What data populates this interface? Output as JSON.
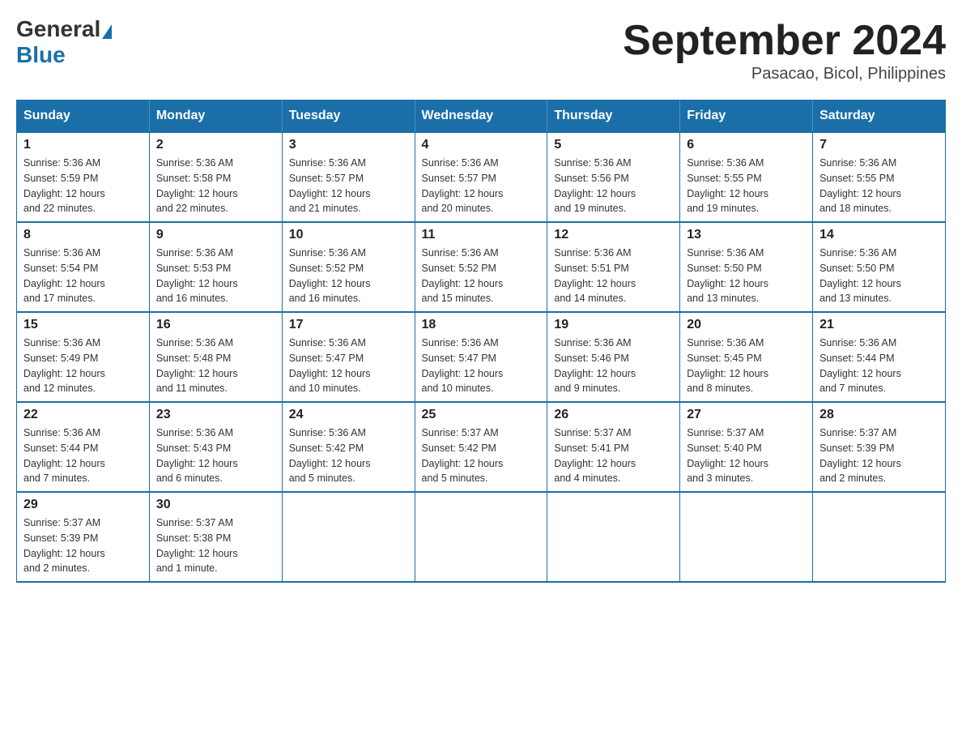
{
  "header": {
    "logo_general": "General",
    "logo_blue": "Blue",
    "month_title": "September 2024",
    "subtitle": "Pasacao, Bicol, Philippines"
  },
  "days_of_week": [
    "Sunday",
    "Monday",
    "Tuesday",
    "Wednesday",
    "Thursday",
    "Friday",
    "Saturday"
  ],
  "weeks": [
    [
      {
        "day": "1",
        "sunrise": "5:36 AM",
        "sunset": "5:59 PM",
        "daylight": "12 hours and 22 minutes."
      },
      {
        "day": "2",
        "sunrise": "5:36 AM",
        "sunset": "5:58 PM",
        "daylight": "12 hours and 22 minutes."
      },
      {
        "day": "3",
        "sunrise": "5:36 AM",
        "sunset": "5:57 PM",
        "daylight": "12 hours and 21 minutes."
      },
      {
        "day": "4",
        "sunrise": "5:36 AM",
        "sunset": "5:57 PM",
        "daylight": "12 hours and 20 minutes."
      },
      {
        "day": "5",
        "sunrise": "5:36 AM",
        "sunset": "5:56 PM",
        "daylight": "12 hours and 19 minutes."
      },
      {
        "day": "6",
        "sunrise": "5:36 AM",
        "sunset": "5:55 PM",
        "daylight": "12 hours and 19 minutes."
      },
      {
        "day": "7",
        "sunrise": "5:36 AM",
        "sunset": "5:55 PM",
        "daylight": "12 hours and 18 minutes."
      }
    ],
    [
      {
        "day": "8",
        "sunrise": "5:36 AM",
        "sunset": "5:54 PM",
        "daylight": "12 hours and 17 minutes."
      },
      {
        "day": "9",
        "sunrise": "5:36 AM",
        "sunset": "5:53 PM",
        "daylight": "12 hours and 16 minutes."
      },
      {
        "day": "10",
        "sunrise": "5:36 AM",
        "sunset": "5:52 PM",
        "daylight": "12 hours and 16 minutes."
      },
      {
        "day": "11",
        "sunrise": "5:36 AM",
        "sunset": "5:52 PM",
        "daylight": "12 hours and 15 minutes."
      },
      {
        "day": "12",
        "sunrise": "5:36 AM",
        "sunset": "5:51 PM",
        "daylight": "12 hours and 14 minutes."
      },
      {
        "day": "13",
        "sunrise": "5:36 AM",
        "sunset": "5:50 PM",
        "daylight": "12 hours and 13 minutes."
      },
      {
        "day": "14",
        "sunrise": "5:36 AM",
        "sunset": "5:50 PM",
        "daylight": "12 hours and 13 minutes."
      }
    ],
    [
      {
        "day": "15",
        "sunrise": "5:36 AM",
        "sunset": "5:49 PM",
        "daylight": "12 hours and 12 minutes."
      },
      {
        "day": "16",
        "sunrise": "5:36 AM",
        "sunset": "5:48 PM",
        "daylight": "12 hours and 11 minutes."
      },
      {
        "day": "17",
        "sunrise": "5:36 AM",
        "sunset": "5:47 PM",
        "daylight": "12 hours and 10 minutes."
      },
      {
        "day": "18",
        "sunrise": "5:36 AM",
        "sunset": "5:47 PM",
        "daylight": "12 hours and 10 minutes."
      },
      {
        "day": "19",
        "sunrise": "5:36 AM",
        "sunset": "5:46 PM",
        "daylight": "12 hours and 9 minutes."
      },
      {
        "day": "20",
        "sunrise": "5:36 AM",
        "sunset": "5:45 PM",
        "daylight": "12 hours and 8 minutes."
      },
      {
        "day": "21",
        "sunrise": "5:36 AM",
        "sunset": "5:44 PM",
        "daylight": "12 hours and 7 minutes."
      }
    ],
    [
      {
        "day": "22",
        "sunrise": "5:36 AM",
        "sunset": "5:44 PM",
        "daylight": "12 hours and 7 minutes."
      },
      {
        "day": "23",
        "sunrise": "5:36 AM",
        "sunset": "5:43 PM",
        "daylight": "12 hours and 6 minutes."
      },
      {
        "day": "24",
        "sunrise": "5:36 AM",
        "sunset": "5:42 PM",
        "daylight": "12 hours and 5 minutes."
      },
      {
        "day": "25",
        "sunrise": "5:37 AM",
        "sunset": "5:42 PM",
        "daylight": "12 hours and 5 minutes."
      },
      {
        "day": "26",
        "sunrise": "5:37 AM",
        "sunset": "5:41 PM",
        "daylight": "12 hours and 4 minutes."
      },
      {
        "day": "27",
        "sunrise": "5:37 AM",
        "sunset": "5:40 PM",
        "daylight": "12 hours and 3 minutes."
      },
      {
        "day": "28",
        "sunrise": "5:37 AM",
        "sunset": "5:39 PM",
        "daylight": "12 hours and 2 minutes."
      }
    ],
    [
      {
        "day": "29",
        "sunrise": "5:37 AM",
        "sunset": "5:39 PM",
        "daylight": "12 hours and 2 minutes."
      },
      {
        "day": "30",
        "sunrise": "5:37 AM",
        "sunset": "5:38 PM",
        "daylight": "12 hours and 1 minute."
      },
      null,
      null,
      null,
      null,
      null
    ]
  ],
  "labels": {
    "sunrise": "Sunrise:",
    "sunset": "Sunset:",
    "daylight": "Daylight:"
  }
}
